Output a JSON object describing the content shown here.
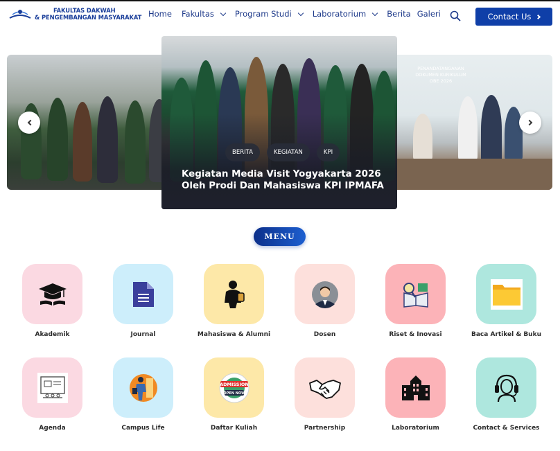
{
  "brand": {
    "line1": "FAKULTAS DAKWAH",
    "line2": "& PENGEMBANGAN MASYARAKAT"
  },
  "nav": [
    {
      "label": "Home",
      "dropdown": false
    },
    {
      "label": "Fakultas",
      "dropdown": true
    },
    {
      "label": "Program Studi",
      "dropdown": true
    },
    {
      "label": "Laboratorium",
      "dropdown": true
    },
    {
      "label": "Berita",
      "dropdown": false
    },
    {
      "label": "Galeri",
      "dropdown": false
    }
  ],
  "contact_button": "Contact Us",
  "slider": {
    "tags": [
      "BERITA",
      "KEGIATAN",
      "KPI"
    ],
    "title": "Kegiatan Media Visit Yogyakarta 2026 Oleh Prodi Dan Mahasiswa KPI IPMAFA",
    "right_banner": [
      "PENANDATANGANAN",
      "DOKUMEN KURIKULUM",
      "OBE 2026"
    ]
  },
  "menu_title": "MENU",
  "menu_items": [
    {
      "label": "Akademik",
      "icon": "graduation-cap-icon",
      "color": "#fbd9e2"
    },
    {
      "label": "Journal",
      "icon": "document-icon",
      "color": "#cdeefb"
    },
    {
      "label": "Mahasiswa & Alumni",
      "icon": "student-icon",
      "color": "#fde8a8"
    },
    {
      "label": "Dosen",
      "icon": "lecturer-icon",
      "color": "#fde0dc"
    },
    {
      "label": "Riset & Inovasi",
      "icon": "research-icon",
      "color": "#fcb3b8"
    },
    {
      "label": "Baca Artikel & Buku",
      "icon": "folder-icon",
      "color": "#aee7de"
    },
    {
      "label": "Agenda",
      "icon": "agenda-icon",
      "color": "#fbd9e2"
    },
    {
      "label": "Campus Life",
      "icon": "campus-life-icon",
      "color": "#cdeefb"
    },
    {
      "label": "Daftar Kuliah",
      "icon": "admission-icon",
      "color": "#fde8a8"
    },
    {
      "label": "Partnership",
      "icon": "handshake-icon",
      "color": "#fde0dc"
    },
    {
      "label": "Laboratorium",
      "icon": "building-icon",
      "color": "#fcb3b8"
    },
    {
      "label": "Contact & Services",
      "icon": "headset-icon",
      "color": "#aee7de"
    }
  ]
}
